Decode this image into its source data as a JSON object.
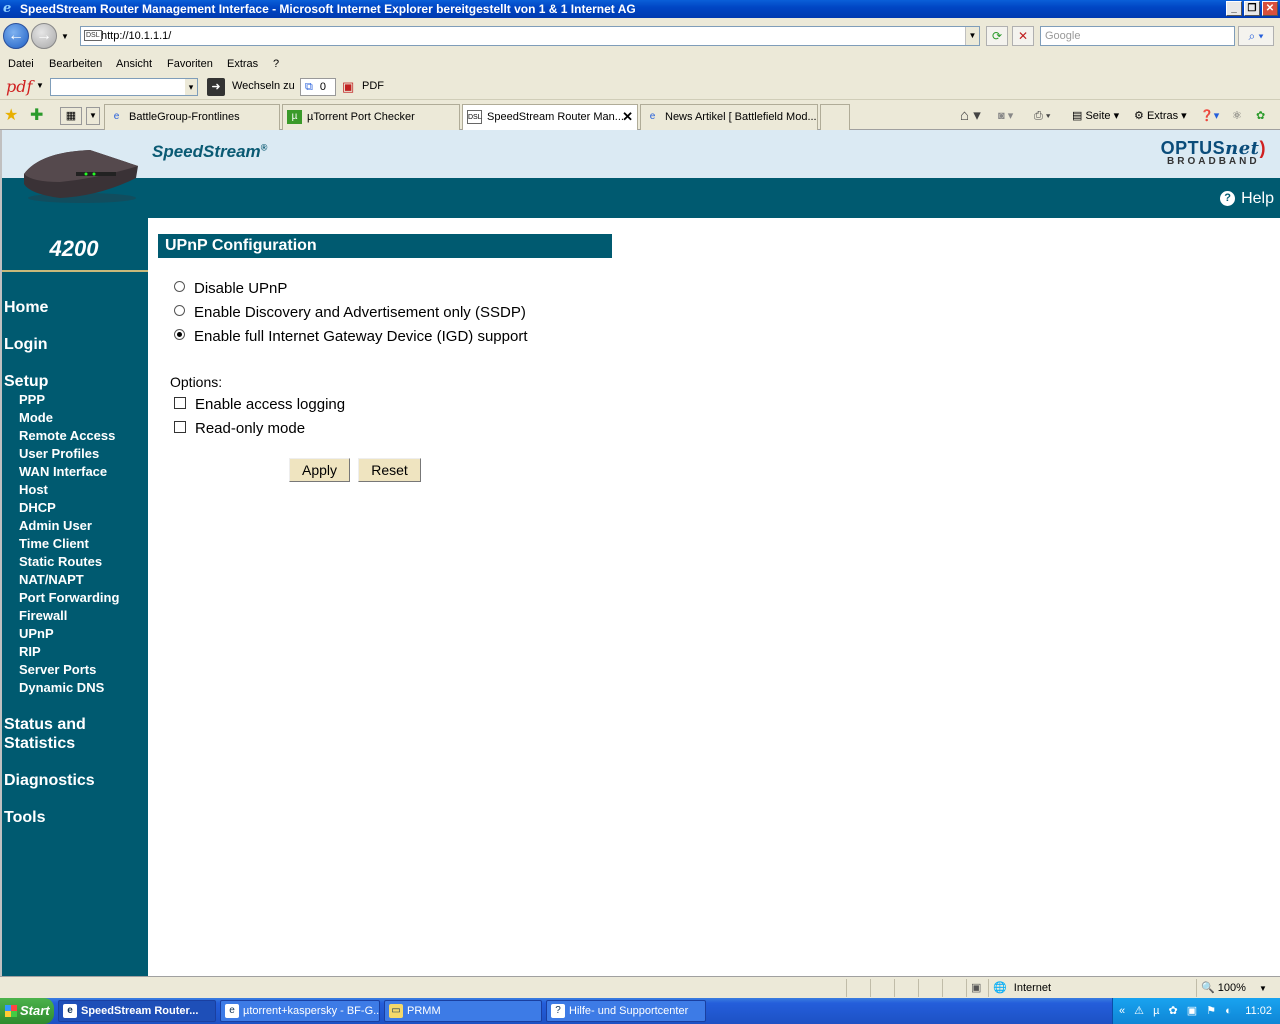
{
  "window": {
    "title": "SpeedStream Router Management Interface - Microsoft Internet Explorer bereitgestellt von 1 & 1 Internet AG"
  },
  "address": {
    "url": "http://10.1.1.1/",
    "search_placeholder": "Google"
  },
  "menu": [
    "Datei",
    "Bearbeiten",
    "Ansicht",
    "Favoriten",
    "Extras",
    "?"
  ],
  "pdf_toolbar": {
    "logo": "pdf",
    "go_label": "Wechseln zu",
    "count": "0",
    "pdf_label": "PDF"
  },
  "tabs": [
    {
      "label": "BattleGroup-Frontlines",
      "icon": "ie-page-icon"
    },
    {
      "label": "µTorrent Port Checker",
      "icon": "utorrent-icon"
    },
    {
      "label": "SpeedStream Router Man...",
      "icon": "dsl-icon"
    },
    {
      "label": "News Artikel [ Battlefield Mod...",
      "icon": "ie-page-icon"
    }
  ],
  "toolbar_right": {
    "seite": "Seite",
    "extras": "Extras"
  },
  "page": {
    "brand": "SpeedStream",
    "brand_reg": "®",
    "isp_logo_main": "OPTUS",
    "isp_logo_net": "net",
    "isp_logo_sub": "BROADBAND",
    "help": "Help",
    "model": "4200",
    "nav_main": [
      "Home",
      "Login",
      "Setup",
      "Status and Statistics",
      "Diagnostics",
      "Tools"
    ],
    "nav_setup": [
      "PPP",
      "Mode",
      "Remote Access",
      "User Profiles",
      "WAN Interface",
      "Host",
      "DHCP",
      "Admin User",
      "Time Client",
      "Static Routes",
      "NAT/NAPT",
      "Port Forwarding",
      "Firewall",
      "UPnP",
      "RIP",
      "Server Ports",
      "Dynamic DNS"
    ],
    "section_title": "UPnP Configuration",
    "radios": [
      {
        "label": "Disable UPnP",
        "selected": false
      },
      {
        "label": "Enable Discovery and Advertisement only (SSDP)",
        "selected": false
      },
      {
        "label": "Enable full Internet Gateway Device (IGD) support",
        "selected": true
      }
    ],
    "options_label": "Options:",
    "checkboxes": [
      {
        "label": "Enable access logging",
        "checked": false
      },
      {
        "label": "Read-only mode",
        "checked": false
      }
    ],
    "apply": "Apply",
    "reset": "Reset"
  },
  "statusbar": {
    "zone": "Internet",
    "zoom": "100%"
  },
  "taskbar": {
    "start": "Start",
    "tasks": [
      {
        "label": "SpeedStream Router...",
        "active": true
      },
      {
        "label": "µtorrent+kaspersky - BF-G...",
        "active": false
      },
      {
        "label": "PRMM",
        "active": false
      },
      {
        "label": "Hilfe- und Supportcenter",
        "active": false
      }
    ],
    "clock": "11:02"
  },
  "colors": {
    "teal": "#005a70",
    "header_bg": "#dbeaf3",
    "button_bg": "#efe4c0"
  }
}
